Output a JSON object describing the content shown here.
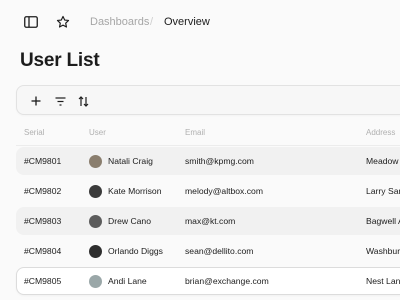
{
  "topbar": {
    "sidebar_toggle_icon": "sidebar-icon",
    "favorite_icon": "star-icon",
    "breadcrumb": [
      "Dashboards",
      "/",
      "Overview"
    ]
  },
  "page": {
    "title": "User List"
  },
  "toolbar": {
    "add_icon": "plus-icon",
    "filter_icon": "filter-icon",
    "sort_icon": "sort-icon"
  },
  "table": {
    "headers": [
      "Serial",
      "User",
      "Email",
      "Address"
    ],
    "rows": [
      {
        "serial": "#CM9801",
        "user": "Natali Craig",
        "email": "smith@kpmg.com",
        "address": "Meadow Lane",
        "avatar_color": "#8a7e6e"
      },
      {
        "serial": "#CM9802",
        "user": "Kate Morrison",
        "email": "melody@altbox.com",
        "address": "Larry San",
        "avatar_color": "#3b3b3b"
      },
      {
        "serial": "#CM9803",
        "user": "Drew Cano",
        "email": "max@kt.com",
        "address": "Bagwell Av",
        "avatar_color": "#5c5c5c"
      },
      {
        "serial": "#CM9804",
        "user": "Orlando Diggs",
        "email": "sean@dellito.com",
        "address": "Washburn",
        "avatar_color": "#2e2e2e"
      },
      {
        "serial": "#CM9805",
        "user": "Andi Lane",
        "email": "brian@exchange.com",
        "address": "Nest Lane",
        "avatar_color": "#9aa7a8"
      }
    ]
  }
}
